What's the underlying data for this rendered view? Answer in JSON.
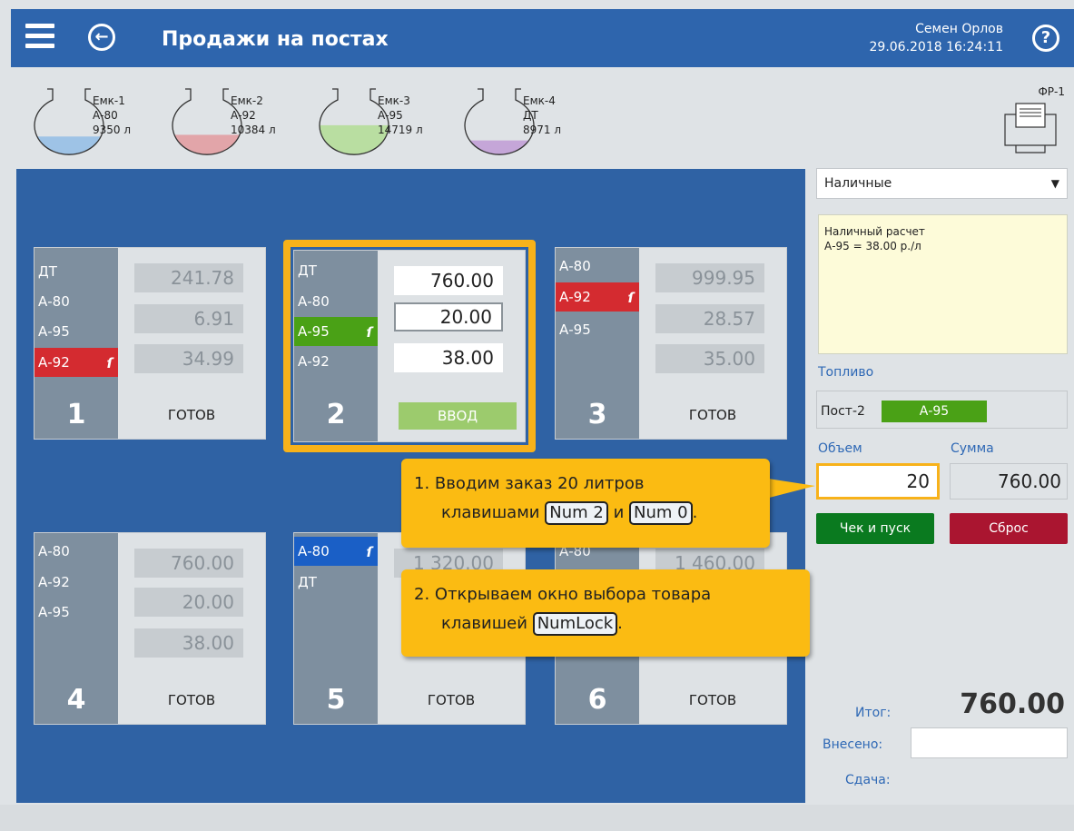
{
  "header": {
    "title": "Продажи на постах",
    "user": "Семен Орлов",
    "datetime": "29.06.2018 16:24:11",
    "help": "?"
  },
  "tanks": [
    {
      "name": "Емк-1",
      "fuel": "А-80",
      "volume": "9350 л",
      "level": 0.35,
      "color": "#9ec3e6"
    },
    {
      "name": "Емк-2",
      "fuel": "А-92",
      "volume": "10384 л",
      "level": 0.38,
      "color": "#e2a5a9"
    },
    {
      "name": "Емк-3",
      "fuel": "А-95",
      "volume": "14719 л",
      "level": 0.55,
      "color": "#b9dea1"
    },
    {
      "name": "Емк-4",
      "fuel": "ДТ",
      "volume": "8971 л",
      "level": 0.28,
      "color": "#c5a6d8"
    }
  ],
  "printer": {
    "label": "ФР-1"
  },
  "posts": [
    {
      "number": "1",
      "status": "ГОТОВ",
      "fuels": [
        "ДТ",
        "А-80",
        "А-95",
        "А-92"
      ],
      "values": [
        "241.78",
        "6.91",
        "34.99"
      ]
    },
    {
      "number": "2",
      "button": "ВВОД",
      "fuels": [
        "ДТ",
        "А-80",
        "А-95",
        "А-92"
      ],
      "values": [
        "760.00",
        "20.00",
        "38.00"
      ]
    },
    {
      "number": "3",
      "status": "ГОТОВ",
      "fuels": [
        "А-80",
        "А-92",
        "А-95"
      ],
      "values": [
        "999.95",
        "28.57",
        "35.00"
      ]
    },
    {
      "number": "4",
      "status": "ГОТОВ",
      "fuels": [
        "А-80",
        "А-92",
        "А-95"
      ],
      "values": [
        "760.00",
        "20.00",
        "38.00"
      ]
    },
    {
      "number": "5",
      "status": "ГОТОВ",
      "fuels": [
        "А-80",
        "ДТ"
      ],
      "values": [
        "1 320.00"
      ]
    },
    {
      "number": "6",
      "status": "ГОТОВ",
      "fuels": [
        "А-80"
      ],
      "values": [
        "1 460.00"
      ]
    }
  ],
  "callouts": {
    "one": {
      "line1": "1. Вводим заказ 20 литров",
      "pre": "клавишами",
      "key1": "Num 2",
      "mid": "и",
      "key2": "Num 0",
      "end": "."
    },
    "two": {
      "line1": "2. Открываем окно выбора товара",
      "pre": "клавишей",
      "key": "NumLock",
      "end": "."
    }
  },
  "panel": {
    "payment": "Наличные",
    "info_line1": "Наличный расчет",
    "info_line2": "А-95 = 38.00 р./л",
    "fuel_label": "Топливо",
    "post_label": "Пост-2",
    "post_fuel": "А-95",
    "volume_label": "Объем",
    "sum_label": "Сумма",
    "volume": "20",
    "sum": "760.00",
    "check_button": "Чек и пуск",
    "reset_button": "Сброс",
    "total_label": "Итог:",
    "total": "760.00",
    "paid_label": "Внесено:",
    "paid": "",
    "change_label": "Сдача:"
  }
}
